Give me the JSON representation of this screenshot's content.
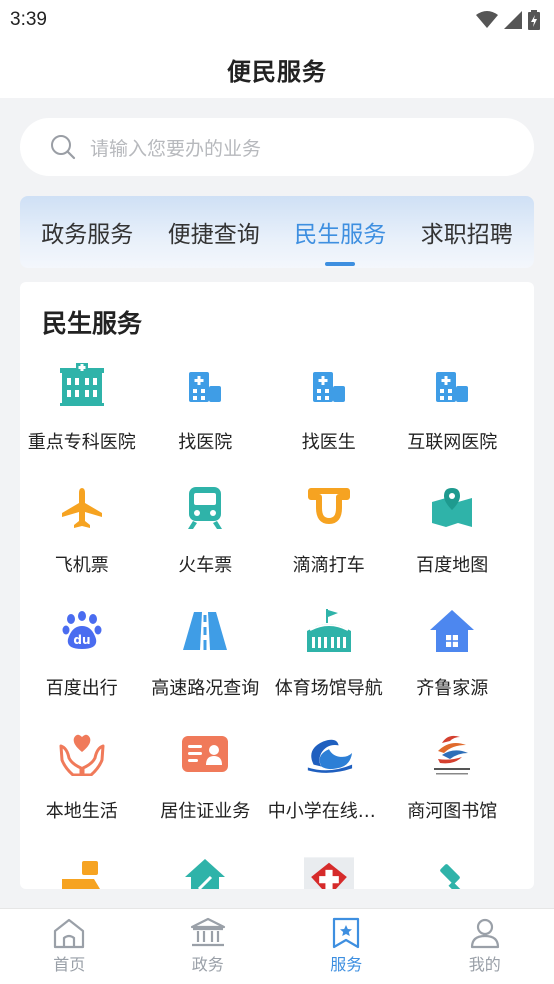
{
  "status_bar": {
    "time": "3:39"
  },
  "header": {
    "title": "便民服务"
  },
  "search": {
    "placeholder": "请输入您要办的业务"
  },
  "tabs": [
    {
      "label": "政务服务",
      "active": false
    },
    {
      "label": "便捷查询",
      "active": false
    },
    {
      "label": "民生服务",
      "active": true
    },
    {
      "label": "求职招聘",
      "active": false
    }
  ],
  "panel": {
    "title": "民生服务",
    "items": [
      {
        "label": "重点专科医院",
        "icon": "hospital-building-icon"
      },
      {
        "label": "找医院",
        "icon": "hospital-icon"
      },
      {
        "label": "找医生",
        "icon": "hospital-icon"
      },
      {
        "label": "互联网医院",
        "icon": "hospital-icon"
      },
      {
        "label": "飞机票",
        "icon": "airplane-icon"
      },
      {
        "label": "火车票",
        "icon": "train-icon"
      },
      {
        "label": "滴滴打车",
        "icon": "didi-icon"
      },
      {
        "label": "百度地图",
        "icon": "map-icon"
      },
      {
        "label": "百度出行",
        "icon": "baidu-paw-icon"
      },
      {
        "label": "高速路况查询",
        "icon": "highway-icon"
      },
      {
        "label": "体育场馆导航",
        "icon": "stadium-icon"
      },
      {
        "label": "齐鲁家源",
        "icon": "house-icon"
      },
      {
        "label": "本地生活",
        "icon": "heart-hands-icon"
      },
      {
        "label": "居住证业务",
        "icon": "id-card-icon"
      },
      {
        "label": "中小学在线教...",
        "icon": "education-icon"
      },
      {
        "label": "商河图书馆",
        "icon": "library-logo-icon"
      }
    ]
  },
  "bottom_nav": [
    {
      "label": "首页",
      "icon": "home-icon",
      "active": false
    },
    {
      "label": "政务",
      "icon": "government-icon",
      "active": false
    },
    {
      "label": "服务",
      "icon": "service-icon",
      "active": true
    },
    {
      "label": "我的",
      "icon": "user-icon",
      "active": false
    }
  ],
  "colors": {
    "accent": "#3e8fe0",
    "hospital_teal": "#2fb3a9",
    "hospital_blue": "#3f9de6",
    "orange": "#f6a321"
  }
}
